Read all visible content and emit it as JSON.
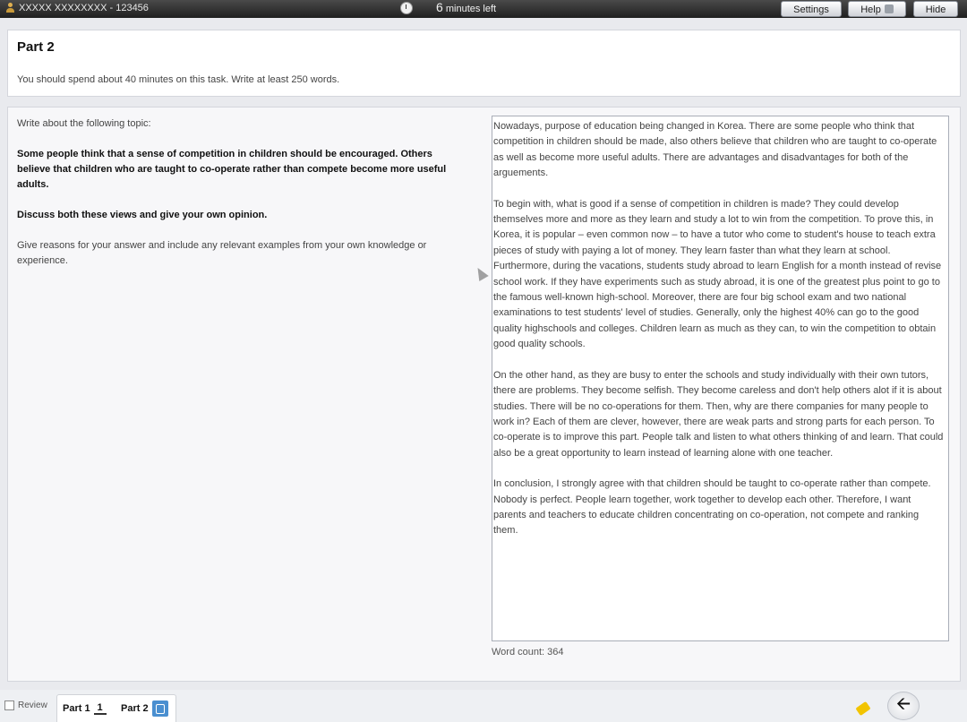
{
  "topbar": {
    "candidate": "XXXXX XXXXXXXX - 123456",
    "timer_value": "6",
    "timer_suffix": "minutes left",
    "settings_label": "Settings",
    "help_label": "Help",
    "hide_label": "Hide"
  },
  "part": {
    "title": "Part 2",
    "instruction": "You should spend about 40 minutes on this task. Write at least 250 words."
  },
  "question": {
    "intro": "Write about the following topic:",
    "prompt": "Some people think that a sense of competition in children should be encouraged. Others believe that children who are taught to co-operate rather than compete become more useful adults.",
    "task": "Discuss both these views and give your own opinion.",
    "guidance": "Give reasons for your answer and include any relevant examples from your own knowledge or experience."
  },
  "answer": {
    "paragraph_1": "Nowadays, purpose of education being changed in Korea. There are some people who think that competition in children should be made, also others believe that children who are taught to co-operate as well as become more useful adults. There are advantages and disadvantages for both of the arguements.",
    "paragraph_2": "To begin with, what is good if a sense of competition in children is made? They could develop themselves more and more as they learn and study a lot to win from the competition. To prove this, in Korea, it is popular – even common now – to have a tutor who come to student's house to teach extra pieces of study with paying a lot of money. They learn faster than what they learn at school.",
    "paragraph_3": "Furthermore, during the vacations, students study abroad to learn English for a month instead of revise school work. If they have experiments such as study abroad, it is one of the greatest plus point to go to the famous well-known high-school. Moreover, there are four big school exam and two national examinations to test students' level of studies. Generally, only the highest 40% can go to the good quality highschools and colleges. Children learn as much as they can, to win the competition to obtain good quality schools.",
    "paragraph_4": "On the other hand, as they are busy to enter the schools and study individually with their own tutors, there are problems. They become selfish. They become careless and don't help others alot if it is about studies. There will be no co-operations for them. Then, why are there companies for many people to work in? Each of them are clever, however, there are weak parts and strong parts for each person. To co-operate is to improve this part. People talk and listen to what others thinking of and learn. That could also be a great opportunity to learn instead of learning alone with one teacher.",
    "paragraph_5": "In conclusion, I strongly agree with that children should be taught to co-operate rather than compete. Nobody is perfect. People learn together, work together to develop each other. Therefore, I want parents and teachers to educate children concentrating on co-operation, not compete and ranking them.",
    "word_count": "Word count: 364"
  },
  "footer": {
    "review_label": "Review",
    "part1_label": "Part 1",
    "part1_num": "1",
    "part2_label": "Part 2"
  }
}
